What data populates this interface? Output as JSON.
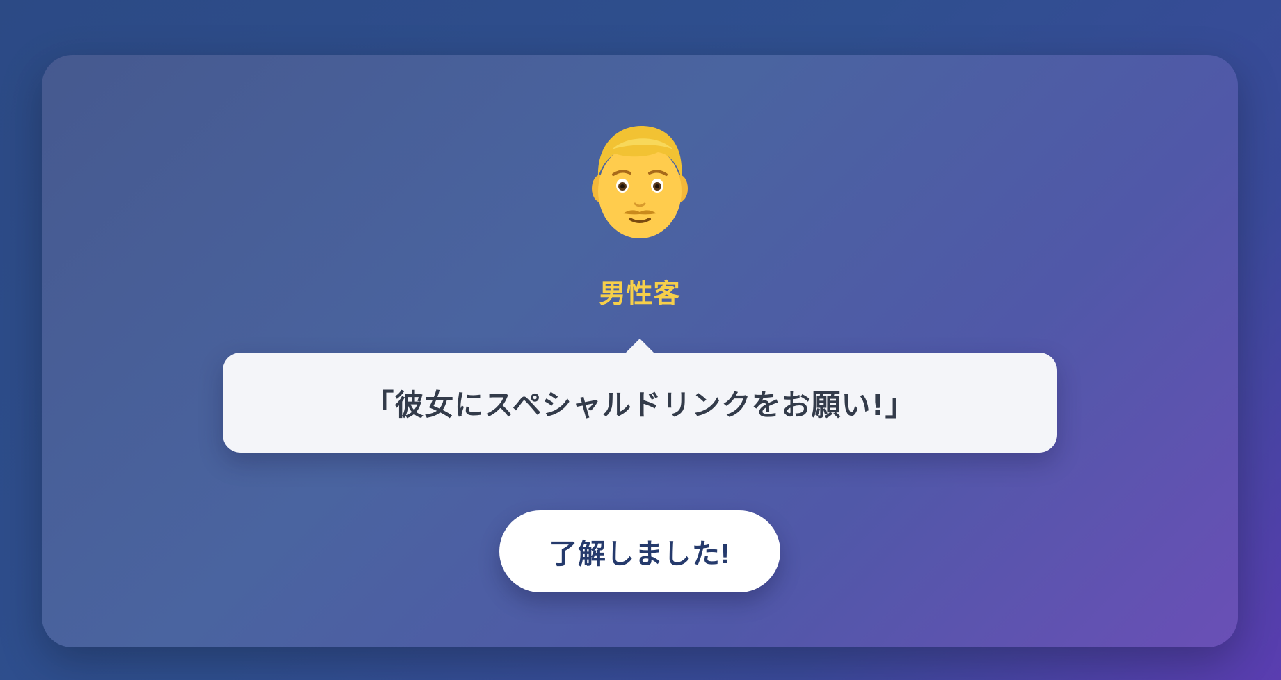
{
  "speaker": {
    "avatar_icon": "man-face-icon",
    "name": "男性客",
    "name_color": "#f6cf4a"
  },
  "dialogue": {
    "text": "「彼女にスペシャルドリンクをお願い!」"
  },
  "actions": {
    "confirm_label": "了解しました!"
  },
  "colors": {
    "background_start": "#2c4a85",
    "background_end": "#5a3db0",
    "bubble": "#f4f5f9",
    "button_text": "#253a6c"
  }
}
